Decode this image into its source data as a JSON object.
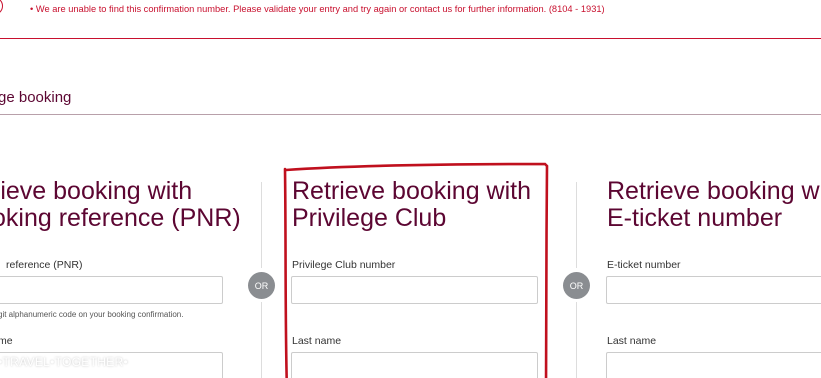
{
  "error": {
    "message": "• We are unable to find this confirmation number. Please validate your entry and try again or contact us for further information. (8104 - 1931)"
  },
  "section": {
    "title": "ge booking"
  },
  "columns": [
    {
      "title_line1": "rieve booking with",
      "title_line2": "oking reference (PNR)",
      "field1_label": "reference (PNR)",
      "field1_hint": "git alphanumeric code on your booking confirmation.",
      "field2_label": "me"
    },
    {
      "title_line1": "Retrieve booking with",
      "title_line2": "Privilege Club",
      "field1_label": "Privilege Club number",
      "field2_label": "Last name"
    },
    {
      "title_line1": "Retrieve booking wi",
      "title_line2": "E-ticket number",
      "field1_label": "E-ticket number",
      "field2_label": "Last name"
    }
  ],
  "or_label": "OR",
  "watermark": "•TRAVEL•TOGETHER•",
  "colors": {
    "brand": "#5c0632",
    "error": "#c8102e",
    "highlight": "#c0101e"
  }
}
